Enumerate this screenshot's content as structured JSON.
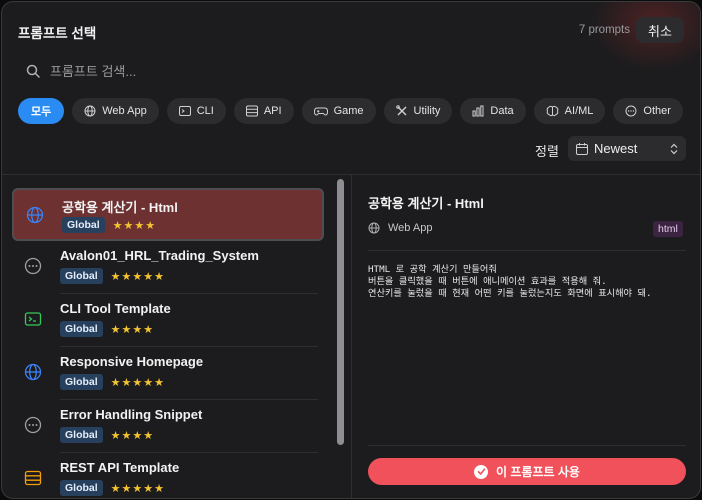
{
  "header": {
    "title": "프롬프트 선택",
    "count": "7 prompts",
    "cancel_label": "취소"
  },
  "search": {
    "placeholder": "프롬프트 검색..."
  },
  "filters": [
    {
      "label": "모두",
      "icon": "none",
      "active": true
    },
    {
      "label": "Web App",
      "icon": "globe-icon"
    },
    {
      "label": "CLI",
      "icon": "terminal-icon"
    },
    {
      "label": "API",
      "icon": "server-icon"
    },
    {
      "label": "Game",
      "icon": "gamepad-icon"
    },
    {
      "label": "Utility",
      "icon": "wrench-icon"
    },
    {
      "label": "Data",
      "icon": "bar-chart-icon"
    },
    {
      "label": "AI/ML",
      "icon": "brain-icon"
    },
    {
      "label": "Other",
      "icon": "ellipsis-icon"
    }
  ],
  "sort": {
    "label": "정렬",
    "value": "Newest"
  },
  "list": [
    {
      "name": "공학용 계산기 - Html",
      "badge": "Global",
      "stars": "★★★★",
      "icon": "globe-icon",
      "selected": true
    },
    {
      "name": "Avalon01_HRL_Trading_System",
      "badge": "Global",
      "stars": "★★★★★",
      "icon": "ellipsis-icon"
    },
    {
      "name": "CLI Tool Template",
      "badge": "Global",
      "stars": "★★★★",
      "icon": "terminal-icon"
    },
    {
      "name": "Responsive Homepage",
      "badge": "Global",
      "stars": "★★★★★",
      "icon": "globe-icon"
    },
    {
      "name": "Error Handling Snippet",
      "badge": "Global",
      "stars": "★★★★",
      "icon": "ellipsis-icon"
    },
    {
      "name": "REST API Template",
      "badge": "Global",
      "stars": "★★★★★",
      "icon": "server-icon"
    }
  ],
  "detail": {
    "title": "공학용 계산기 - Html",
    "category": "Web App",
    "tag": "html",
    "body": "HTML 로 공학 계산기 만들어줘\n버튼을 클릭했을 때 버튼에 애니메이션 효과를 적용해 줘.\n연산키를 눌렀을 때 현재 어떤 키를 눌렀는지도 화면에 표시해야 돼.",
    "use_label": "이 프롬프트 사용"
  },
  "colors": {
    "accent_blue": "#2a8bf2",
    "use_button": "#f0515a",
    "selected_row": "#6e3131",
    "star": "#f4c430"
  }
}
